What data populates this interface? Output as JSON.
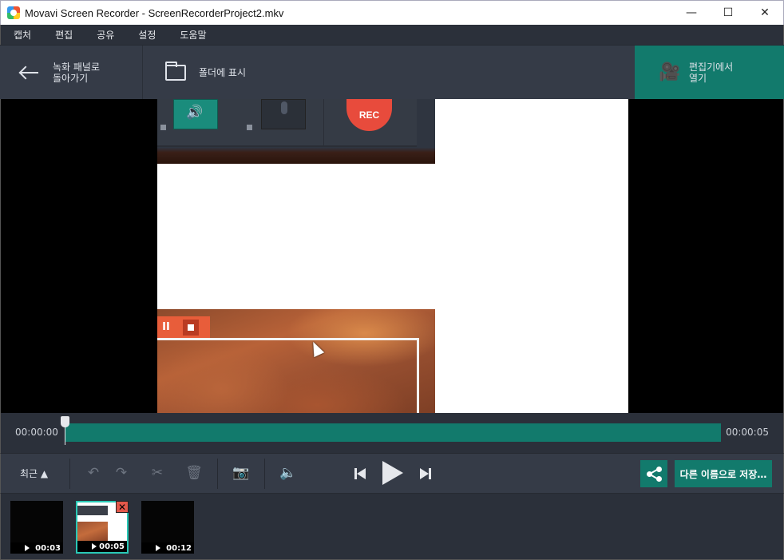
{
  "window": {
    "title": "Movavi Screen Recorder - ScreenRecorderProject2.mkv",
    "minimize": "—",
    "maximize": "☐",
    "close": "✕"
  },
  "menu": [
    "캡처",
    "편집",
    "공유",
    "설정",
    "도움말"
  ],
  "toolbar": {
    "back_line1": "녹화 패널로",
    "back_line2": "돌아가기",
    "show_in_folder": "폴더에 표시",
    "open_editor_line1": "편집기에서",
    "open_editor_line2": "열기"
  },
  "preview": {
    "rec_label": "REC",
    "pause_label": "II"
  },
  "timeline": {
    "current_time": "00:00:00",
    "total_time": "00:00:05",
    "playhead_fraction": 0.0
  },
  "controls": {
    "recent_label": "최근 ▲",
    "save_as_label": "다른 이름으로 저장…"
  },
  "thumbnails": [
    {
      "duration": "00:03",
      "selected": false
    },
    {
      "duration": "00:05",
      "selected": true
    },
    {
      "duration": "00:12",
      "selected": false
    }
  ],
  "colors": {
    "accent": "#127a6c",
    "rec": "#e84b3c",
    "background": "#2b303a"
  },
  "icons": [
    "app-icon",
    "back-arrow-icon",
    "folder-icon",
    "film-camera-icon",
    "undo-icon",
    "redo-icon",
    "scissors-icon",
    "trash-icon",
    "camera-icon",
    "volume-icon",
    "previous-icon",
    "play-icon",
    "next-icon",
    "share-icon",
    "close-icon"
  ]
}
